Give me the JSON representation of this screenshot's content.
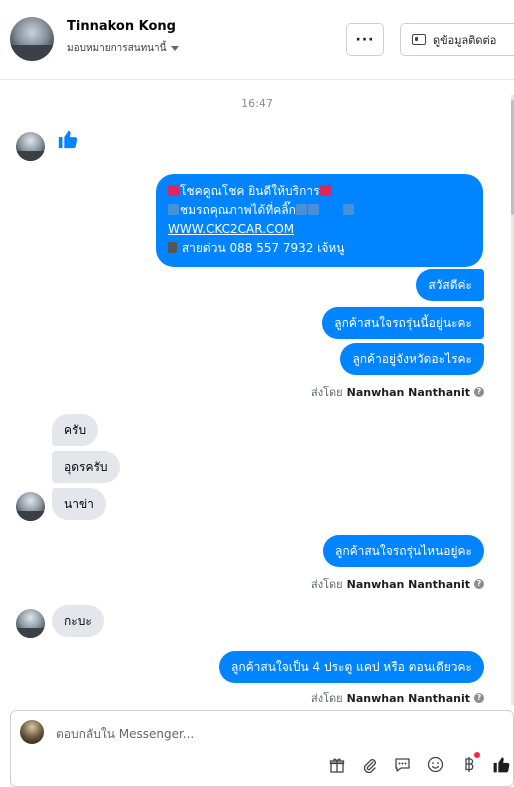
{
  "header": {
    "name": "Tinnakon Kong",
    "assign_label": "มอบหมายการสนทนานี้",
    "more_label": "···",
    "contact_label": "ดูข้อมูลติดต่อ"
  },
  "chat": {
    "timestamp": "16:47",
    "promo_lines": {
      "line1": "โชคคูณโชค ยินดีให้บริการ",
      "line2": "ชมรถคุณภาพได้ที่คลิ๊ก",
      "line3": "WWW.CKC2CAR.COM",
      "line4": "สายด่วน 088 557 7932 เจ้หนู"
    },
    "out_1": "สวัสดีค่ะ",
    "out_2": "ลูกค้าสนใจรถรุ่นนี้อยู่นะคะ",
    "out_3": "ลูกค้าอยู่จังหวัดอะไรคะ",
    "sent_prefix": "ส่งโดย",
    "sent_name": "Nanwhan Nanthanit",
    "in_1": "ครับ",
    "in_2": "อุดรครับ",
    "in_3": "นาข่า",
    "out_4": "ลูกค้าสนใจรถรุ่นไหนอยู่คะ",
    "in_4": "กะบะ",
    "out_5": "ลูกค้าสนใจเป็น 4 ประตู แคป หรือ ตอนเดียวคะ"
  },
  "composer": {
    "placeholder": "ตอบกลับใน Messenger..."
  },
  "icons": [
    "thumbs-up-icon",
    "card-icon",
    "gift-icon",
    "paperclip-icon",
    "speech-icon",
    "emoji-icon",
    "baht-icon",
    "like-icon"
  ],
  "colors": {
    "accent": "#0084ff",
    "incoming": "#e4e6eb",
    "notify": "#f02849"
  }
}
